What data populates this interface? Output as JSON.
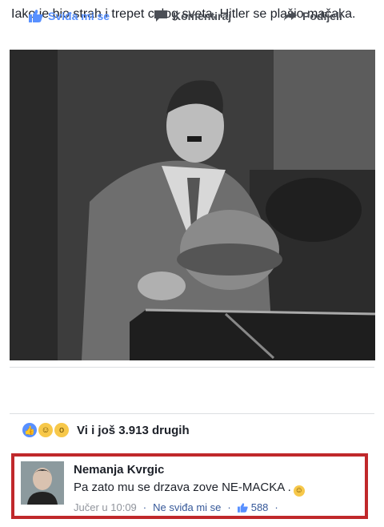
{
  "post": {
    "text": "Iako je bio strah i trepet celog sveta, Hitler se plašio mačaka."
  },
  "actions": {
    "like_label": "Sviđa mi se",
    "comment_label": "Komentiraj",
    "share_label": "Podijeli"
  },
  "reactions": {
    "icons": [
      "like-icon",
      "haha-icon",
      "wow-icon"
    ],
    "summary": "Vi i još 3.913 drugih"
  },
  "comment": {
    "author": "Nemanja Kvrgic",
    "text": "Pa zato mu se drzava zove NE-MACKA .",
    "time": "Jučer u 10:09",
    "unlike_label": "Ne sviđa mi se",
    "like_count": "588"
  },
  "colors": {
    "like_blue": "#5890ff",
    "link_blue": "#365899",
    "highlight_red": "#c0282b"
  }
}
